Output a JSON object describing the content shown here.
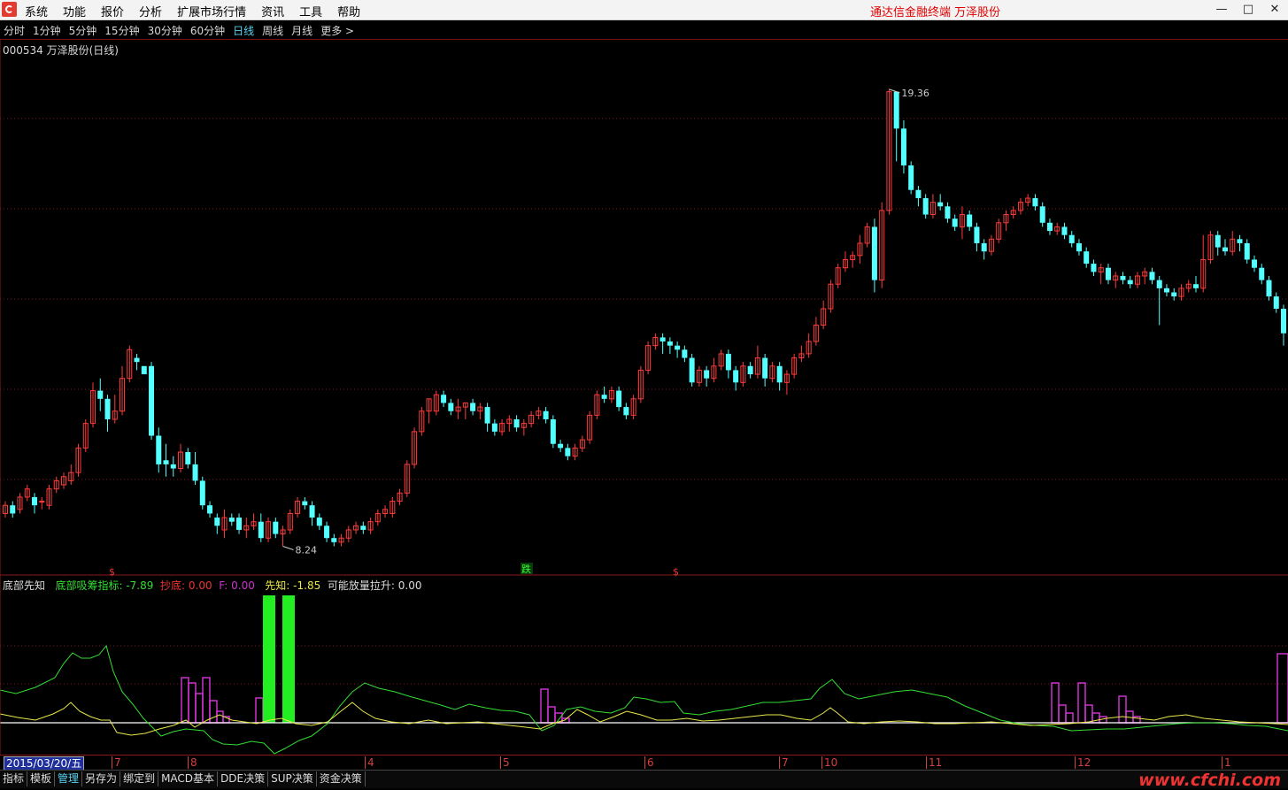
{
  "menubar": {
    "items": [
      "系统",
      "功能",
      "报价",
      "分析",
      "扩展市场行情",
      "资讯",
      "工具",
      "帮助"
    ],
    "brand": "通达信金融终端  万泽股份"
  },
  "period_tabs": {
    "items": [
      "分时",
      "1分钟",
      "5分钟",
      "15分钟",
      "30分钟",
      "60分钟",
      "日线",
      "周线",
      "月线",
      "更多 >"
    ],
    "active_index": 6
  },
  "chart_title": "000534 万泽股份(日线)",
  "annotations": {
    "high": "19.36",
    "low": "8.24",
    "signal_label": "跌",
    "signal_dollar": "$"
  },
  "indicator": {
    "name": "底部先知",
    "line1_label": "底部吸筹指标:",
    "line1_value": "-7.89",
    "line2_label": "抄底:",
    "line2_value": "0.00",
    "line3_label": "F:",
    "line3_value": "0.00",
    "line4_label": "先知:",
    "line4_value": "-1.85",
    "line5_label": "可能放量拉升:",
    "line5_value": "0.00"
  },
  "date_axis": {
    "current_date": "2015/03/20/五",
    "ticks": [
      "7",
      "8",
      "4",
      "5",
      "6",
      "7",
      "10",
      "11",
      "12",
      "1"
    ]
  },
  "bottom_tabs": {
    "items": [
      "指标",
      "模板",
      "管理",
      "另存为",
      "绑定到",
      "MACD基本",
      "DDE决策",
      "SUP决策",
      "资金决策"
    ],
    "active_index": 2
  },
  "watermark": "www.cfchi.com",
  "colors": {
    "up": "#ff3b3b",
    "down": "#54ffff",
    "green_line": "#33dd33",
    "yellow_line": "#e8e84a",
    "magenta": "#cc33cc",
    "bright_green": "#22ee22"
  },
  "chart_data": {
    "type": "candlestick",
    "title": "000534 万泽股份(日线)",
    "high_label": 19.36,
    "low_label": 8.24,
    "y_range": [
      7.8,
      20.2
    ],
    "candles": [
      [
        9.0,
        9.2,
        8.9,
        9.3
      ],
      [
        9.2,
        9.0,
        8.9,
        9.3
      ],
      [
        9.1,
        9.4,
        9.0,
        9.5
      ],
      [
        9.4,
        9.6,
        9.3,
        9.7
      ],
      [
        9.4,
        9.2,
        9.0,
        9.5
      ],
      [
        9.3,
        9.3,
        9.1,
        9.4
      ],
      [
        9.2,
        9.6,
        9.1,
        9.7
      ],
      [
        9.6,
        9.8,
        9.5,
        9.9
      ],
      [
        9.7,
        9.9,
        9.6,
        10.0
      ],
      [
        9.8,
        10.0,
        9.7,
        10.2
      ],
      [
        10.0,
        10.6,
        9.9,
        10.7
      ],
      [
        10.6,
        11.2,
        10.5,
        11.3
      ],
      [
        11.2,
        12.0,
        11.1,
        12.2
      ],
      [
        12.0,
        11.8,
        11.5,
        12.3
      ],
      [
        11.8,
        11.3,
        11.0,
        11.9
      ],
      [
        11.3,
        11.5,
        11.2,
        11.9
      ],
      [
        11.5,
        12.3,
        11.4,
        12.6
      ],
      [
        12.3,
        13.0,
        12.2,
        13.1
      ],
      [
        12.8,
        12.7,
        12.5,
        12.9
      ],
      [
        12.6,
        12.4,
        12.4,
        12.6
      ],
      [
        12.6,
        10.9,
        10.8,
        12.7
      ],
      [
        10.9,
        10.2,
        10.0,
        11.1
      ],
      [
        10.3,
        10.2,
        9.9,
        10.7
      ],
      [
        10.2,
        10.1,
        9.9,
        10.4
      ],
      [
        10.1,
        10.5,
        10.0,
        10.7
      ],
      [
        10.5,
        10.2,
        10.1,
        10.6
      ],
      [
        10.2,
        9.8,
        9.7,
        10.5
      ],
      [
        9.8,
        9.2,
        9.1,
        9.9
      ],
      [
        9.2,
        9.0,
        8.9,
        9.3
      ],
      [
        8.9,
        8.7,
        8.5,
        9.0
      ],
      [
        8.6,
        8.9,
        8.4,
        9.1
      ],
      [
        8.9,
        8.8,
        8.7,
        9.0
      ],
      [
        8.9,
        8.6,
        8.5,
        9.0
      ],
      [
        8.6,
        8.7,
        8.4,
        8.9
      ],
      [
        8.7,
        8.8,
        8.6,
        9.0
      ],
      [
        8.8,
        8.4,
        8.3,
        9.0
      ],
      [
        8.4,
        8.8,
        8.3,
        8.9
      ],
      [
        8.8,
        8.5,
        8.4,
        8.9
      ],
      [
        8.5,
        8.6,
        8.2,
        8.7
      ],
      [
        8.6,
        9.0,
        8.5,
        9.1
      ],
      [
        9.0,
        9.3,
        8.9,
        9.4
      ],
      [
        9.3,
        9.2,
        9.1,
        9.4
      ],
      [
        9.2,
        8.9,
        8.7,
        9.3
      ],
      [
        8.9,
        8.7,
        8.6,
        9.0
      ],
      [
        8.7,
        8.4,
        8.3,
        8.8
      ],
      [
        8.4,
        8.3,
        8.2,
        8.5
      ],
      [
        8.3,
        8.4,
        8.2,
        8.5
      ],
      [
        8.4,
        8.6,
        8.3,
        8.7
      ],
      [
        8.6,
        8.7,
        8.5,
        8.8
      ],
      [
        8.7,
        8.6,
        8.5,
        8.8
      ],
      [
        8.6,
        8.8,
        8.5,
        8.9
      ],
      [
        8.8,
        9.0,
        8.7,
        9.1
      ],
      [
        9.0,
        9.1,
        8.9,
        9.2
      ],
      [
        9.0,
        9.3,
        8.9,
        9.4
      ],
      [
        9.3,
        9.5,
        9.2,
        9.6
      ],
      [
        9.5,
        10.2,
        9.4,
        10.3
      ],
      [
        10.2,
        11.0,
        10.1,
        11.1
      ],
      [
        11.0,
        11.5,
        10.9,
        11.6
      ],
      [
        11.5,
        11.8,
        11.2,
        11.8
      ],
      [
        11.5,
        11.9,
        11.4,
        12.0
      ],
      [
        11.9,
        11.7,
        11.6,
        12.0
      ],
      [
        11.7,
        11.5,
        11.4,
        11.8
      ],
      [
        11.5,
        11.6,
        11.3,
        11.8
      ],
      [
        11.6,
        11.7,
        11.3,
        11.7
      ],
      [
        11.7,
        11.5,
        11.4,
        11.8
      ],
      [
        11.5,
        11.6,
        11.3,
        11.7
      ],
      [
        11.6,
        11.2,
        11.0,
        11.7
      ],
      [
        11.2,
        11.0,
        10.9,
        11.3
      ],
      [
        11.0,
        11.2,
        10.9,
        11.3
      ],
      [
        11.2,
        11.3,
        11.0,
        11.4
      ],
      [
        11.3,
        11.1,
        11.0,
        11.4
      ],
      [
        11.1,
        11.2,
        10.9,
        11.3
      ],
      [
        11.2,
        11.4,
        11.1,
        11.5
      ],
      [
        11.4,
        11.5,
        11.3,
        11.6
      ],
      [
        11.5,
        11.3,
        11.2,
        11.6
      ],
      [
        11.3,
        10.7,
        10.6,
        11.4
      ],
      [
        10.7,
        10.6,
        10.5,
        10.8
      ],
      [
        10.6,
        10.4,
        10.3,
        10.7
      ],
      [
        10.4,
        10.6,
        10.3,
        10.7
      ],
      [
        10.6,
        10.8,
        10.5,
        10.9
      ],
      [
        10.8,
        11.4,
        10.7,
        11.5
      ],
      [
        11.4,
        11.9,
        11.3,
        12.0
      ],
      [
        11.9,
        11.8,
        11.7,
        12.1
      ],
      [
        11.8,
        12.0,
        11.7,
        12.1
      ],
      [
        12.0,
        11.6,
        11.5,
        12.1
      ],
      [
        11.6,
        11.4,
        11.3,
        11.7
      ],
      [
        11.4,
        11.8,
        11.3,
        11.9
      ],
      [
        11.8,
        12.5,
        11.7,
        12.6
      ],
      [
        12.5,
        13.1,
        12.4,
        13.2
      ],
      [
        13.1,
        13.3,
        13.0,
        13.4
      ],
      [
        13.3,
        13.2,
        12.9,
        13.4
      ],
      [
        13.2,
        13.1,
        12.9,
        13.3
      ],
      [
        13.1,
        13.0,
        12.8,
        13.2
      ],
      [
        13.0,
        12.8,
        12.7,
        13.1
      ],
      [
        12.8,
        12.2,
        12.1,
        12.9
      ],
      [
        12.2,
        12.5,
        12.1,
        12.6
      ],
      [
        12.5,
        12.3,
        12.1,
        12.6
      ],
      [
        12.3,
        12.6,
        12.2,
        12.8
      ],
      [
        12.6,
        12.9,
        12.5,
        13.0
      ],
      [
        12.9,
        12.5,
        12.3,
        13.0
      ],
      [
        12.5,
        12.2,
        12.0,
        12.6
      ],
      [
        12.2,
        12.6,
        12.1,
        12.7
      ],
      [
        12.6,
        12.4,
        12.3,
        12.7
      ],
      [
        12.4,
        12.8,
        12.3,
        13.1
      ],
      [
        12.8,
        12.3,
        12.1,
        12.9
      ],
      [
        12.3,
        12.6,
        12.2,
        12.7
      ],
      [
        12.6,
        12.2,
        12.0,
        12.7
      ],
      [
        12.2,
        12.4,
        11.9,
        12.5
      ],
      [
        12.4,
        12.8,
        12.3,
        12.9
      ],
      [
        12.8,
        12.9,
        12.7,
        13.1
      ],
      [
        12.9,
        13.2,
        12.8,
        13.4
      ],
      [
        13.2,
        13.6,
        13.1,
        13.8
      ],
      [
        13.6,
        14.0,
        13.5,
        14.2
      ],
      [
        14.0,
        14.6,
        13.9,
        14.7
      ],
      [
        14.6,
        15.0,
        14.5,
        15.1
      ],
      [
        15.0,
        15.2,
        14.9,
        15.4
      ],
      [
        15.2,
        15.3,
        15.0,
        15.4
      ],
      [
        15.3,
        15.6,
        15.1,
        15.8
      ],
      [
        15.6,
        16.0,
        15.5,
        16.1
      ],
      [
        16.0,
        14.7,
        14.4,
        16.2
      ],
      [
        14.7,
        16.4,
        14.5,
        16.6
      ],
      [
        16.4,
        19.3,
        16.3,
        19.36
      ],
      [
        19.3,
        18.4,
        17.6,
        19.1
      ],
      [
        18.4,
        17.5,
        17.3,
        18.6
      ],
      [
        17.5,
        16.9,
        16.8,
        17.6
      ],
      [
        16.9,
        16.7,
        16.5,
        17.0
      ],
      [
        16.7,
        16.3,
        16.2,
        16.8
      ],
      [
        16.3,
        16.6,
        16.2,
        16.8
      ],
      [
        16.6,
        16.5,
        16.4,
        16.8
      ],
      [
        16.5,
        16.2,
        16.1,
        16.6
      ],
      [
        16.2,
        16.0,
        15.9,
        16.3
      ],
      [
        16.0,
        16.3,
        15.7,
        16.5
      ],
      [
        16.3,
        16.0,
        15.9,
        16.4
      ],
      [
        16.0,
        15.6,
        15.4,
        16.1
      ],
      [
        15.6,
        15.4,
        15.2,
        15.7
      ],
      [
        15.4,
        15.7,
        15.3,
        15.8
      ],
      [
        15.7,
        16.1,
        15.6,
        16.2
      ],
      [
        16.1,
        16.3,
        15.9,
        16.4
      ],
      [
        16.3,
        16.4,
        16.2,
        16.5
      ],
      [
        16.4,
        16.6,
        16.3,
        16.7
      ],
      [
        16.6,
        16.7,
        16.5,
        16.8
      ],
      [
        16.7,
        16.5,
        16.4,
        16.8
      ],
      [
        16.5,
        16.1,
        16.0,
        16.6
      ],
      [
        16.1,
        15.9,
        15.8,
        16.2
      ],
      [
        15.9,
        16.0,
        15.8,
        16.1
      ],
      [
        16.0,
        15.8,
        15.7,
        16.1
      ],
      [
        15.8,
        15.6,
        15.5,
        15.9
      ],
      [
        15.6,
        15.4,
        15.3,
        15.7
      ],
      [
        15.4,
        15.1,
        15.0,
        15.5
      ],
      [
        15.1,
        14.9,
        14.8,
        15.2
      ],
      [
        14.9,
        15.0,
        14.6,
        15.1
      ],
      [
        15.0,
        14.7,
        14.6,
        15.1
      ],
      [
        14.7,
        14.8,
        14.5,
        14.9
      ],
      [
        14.8,
        14.7,
        14.6,
        14.9
      ],
      [
        14.7,
        14.6,
        14.5,
        14.8
      ],
      [
        14.6,
        14.8,
        14.5,
        14.9
      ],
      [
        14.8,
        14.9,
        14.6,
        15.0
      ],
      [
        14.9,
        14.7,
        14.6,
        15.0
      ],
      [
        14.7,
        14.5,
        13.6,
        14.8
      ],
      [
        14.5,
        14.4,
        14.3,
        14.6
      ],
      [
        14.4,
        14.3,
        14.2,
        14.5
      ],
      [
        14.3,
        14.5,
        14.2,
        14.6
      ],
      [
        14.5,
        14.6,
        14.4,
        14.7
      ],
      [
        14.6,
        14.5,
        14.4,
        14.8
      ],
      [
        14.5,
        15.2,
        14.4,
        15.8
      ],
      [
        15.2,
        15.8,
        15.1,
        15.9
      ],
      [
        15.8,
        15.5,
        15.3,
        15.9
      ],
      [
        15.5,
        15.4,
        15.3,
        15.7
      ],
      [
        15.4,
        15.7,
        15.3,
        15.9
      ],
      [
        15.7,
        15.6,
        15.4,
        15.8
      ],
      [
        15.6,
        15.2,
        15.1,
        15.7
      ],
      [
        15.2,
        15.0,
        14.9,
        15.3
      ],
      [
        15.0,
        14.7,
        14.6,
        15.1
      ],
      [
        14.7,
        14.3,
        14.2,
        14.8
      ],
      [
        14.3,
        14.0,
        13.9,
        14.4
      ],
      [
        14.0,
        13.4,
        13.1,
        14.1
      ]
    ]
  }
}
